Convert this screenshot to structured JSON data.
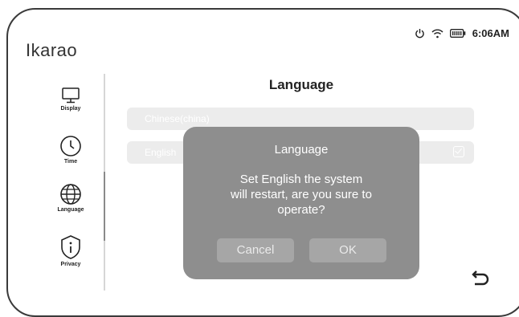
{
  "app": {
    "brand": "Ikarao"
  },
  "status": {
    "time": "6:06AM",
    "icons": [
      "power-icon",
      "wifi-icon",
      "battery-icon"
    ]
  },
  "sidebar": {
    "items": [
      {
        "label": "Display",
        "icon": "monitor-icon"
      },
      {
        "label": "Time",
        "icon": "clock-icon"
      },
      {
        "label": "Language",
        "icon": "globe-icon"
      },
      {
        "label": "Privacy",
        "icon": "info-shield-icon"
      }
    ]
  },
  "main": {
    "title": "Language",
    "languages": [
      {
        "label": "Chinese(china)",
        "selected": false
      },
      {
        "label": "English",
        "selected": true
      }
    ]
  },
  "dialog": {
    "title": "Language",
    "message_lines": [
      "Set English the system",
      "will restart, are you sure to",
      "operate?"
    ],
    "cancel_label": "Cancel",
    "ok_label": "OK"
  },
  "footer": {
    "back_icon": "back-arrow-icon"
  },
  "colors": {
    "dialog_bg": "#8e8e8e",
    "row_bg": "#ececec",
    "button_bg": "#a6a6a6"
  }
}
